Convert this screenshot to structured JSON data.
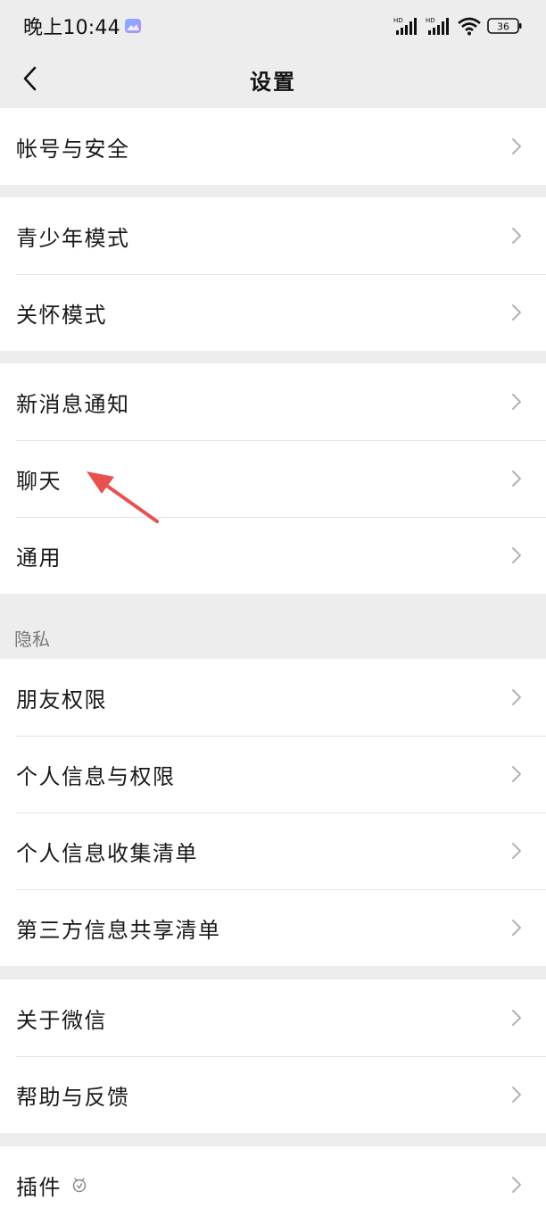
{
  "status_bar": {
    "time": "晚上10:44",
    "network_badge_1": "HD",
    "network_badge_2": "HD",
    "battery": "36"
  },
  "nav": {
    "title": "设置",
    "back_icon": "chevron-left-icon"
  },
  "groups": [
    {
      "items": [
        {
          "label": "帐号与安全"
        }
      ]
    },
    {
      "items": [
        {
          "label": "青少年模式"
        },
        {
          "label": "关怀模式"
        }
      ]
    },
    {
      "items": [
        {
          "label": "新消息通知"
        },
        {
          "label": "聊天"
        },
        {
          "label": "通用"
        }
      ]
    },
    {
      "section_label": "隐私",
      "items": [
        {
          "label": "朋友权限"
        },
        {
          "label": "个人信息与权限"
        },
        {
          "label": "个人信息收集清单"
        },
        {
          "label": "第三方信息共享清单"
        }
      ]
    },
    {
      "items": [
        {
          "label": "关于微信"
        },
        {
          "label": "帮助与反馈"
        }
      ]
    },
    {
      "items": [
        {
          "label": "插件",
          "icon": "plugin-icon"
        }
      ]
    }
  ],
  "colors": {
    "background": "#ededed",
    "row_bg": "#ffffff",
    "chevron": "#b2b2b2",
    "annotation_arrow": "#e8514f"
  }
}
